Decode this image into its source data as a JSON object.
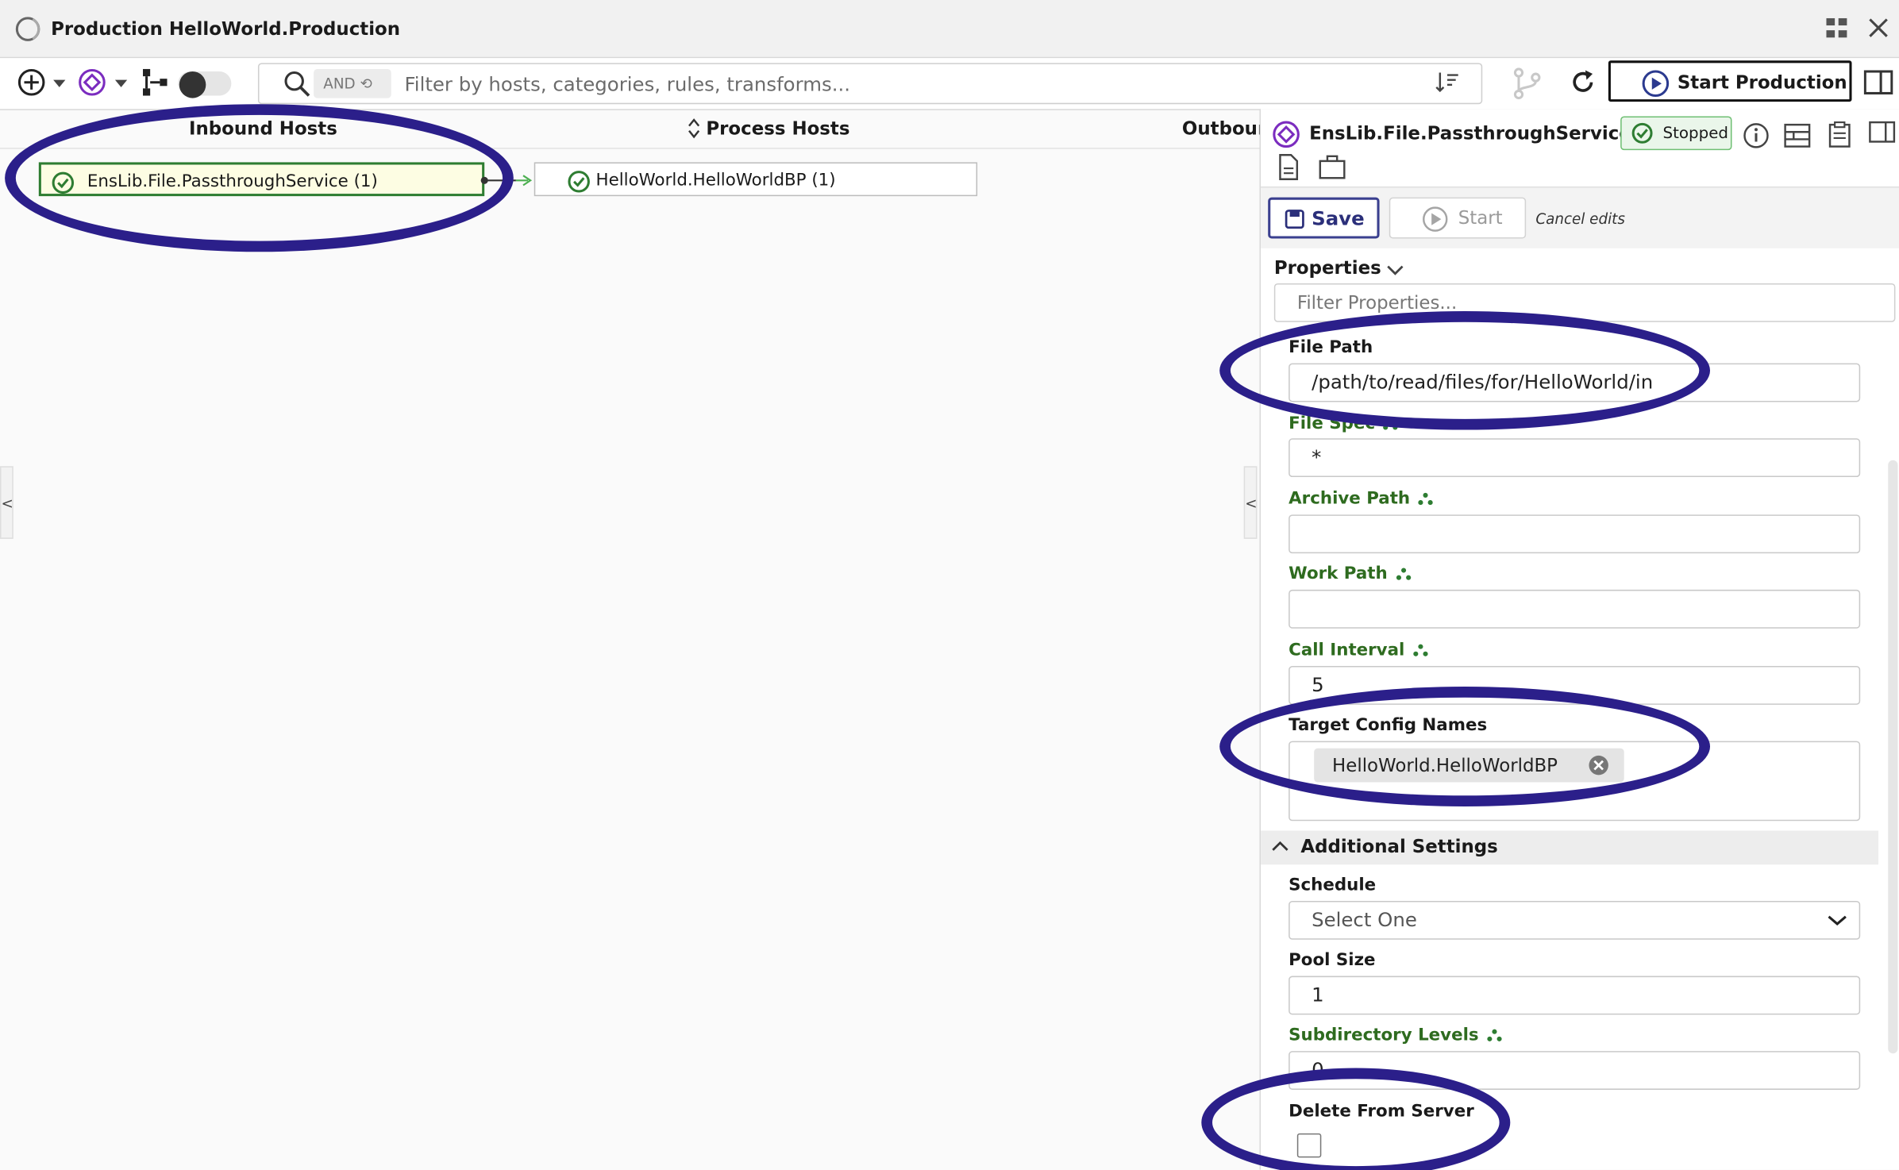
{
  "window": {
    "title": "Production HelloWorld.Production"
  },
  "toolbar": {
    "and_label": "AND",
    "search_placeholder": "Filter by hosts, categories, rules, transforms...",
    "start_production_label": "Start Production"
  },
  "columns": {
    "inbound": "Inbound Hosts",
    "process": "Process Hosts",
    "outbound": "Outbour"
  },
  "hosts": {
    "inbound": [
      {
        "label": "EnsLib.File.PassthroughService (1)",
        "status": "ok"
      }
    ],
    "process": [
      {
        "label": "HelloWorld.HelloWorldBP (1)",
        "status": "ok"
      }
    ]
  },
  "panel": {
    "title": "EnsLib.File.PassthroughService",
    "status": "Stopped",
    "save_label": "Save",
    "start_label": "Start",
    "cancel_label": "Cancel edits",
    "properties_heading": "Properties",
    "filter_placeholder": "Filter Properties...",
    "fields": {
      "file_path": {
        "label": "File Path",
        "value": "/path/to/read/files/for/HelloWorld/in"
      },
      "file_spec": {
        "label": "File Spec",
        "value": "*"
      },
      "archive_path": {
        "label": "Archive Path",
        "value": ""
      },
      "work_path": {
        "label": "Work Path",
        "value": ""
      },
      "call_interval": {
        "label": "Call Interval",
        "value": "5"
      },
      "target_config": {
        "label": "Target Config Names",
        "chip": "HelloWorld.HelloWorldBP"
      }
    },
    "additional_settings": "Additional Settings",
    "fields2": {
      "schedule": {
        "label": "Schedule",
        "value": "Select One"
      },
      "pool_size": {
        "label": "Pool Size",
        "value": "1"
      },
      "subdirectory_levels": {
        "label": "Subdirectory Levels",
        "value": "0"
      },
      "delete_from_server": {
        "label": "Delete From Server",
        "checked": false
      }
    }
  },
  "colors": {
    "annotation": "#2b1f8a",
    "ok_green": "#2e7d32",
    "setting_green": "#2e6b1f"
  }
}
